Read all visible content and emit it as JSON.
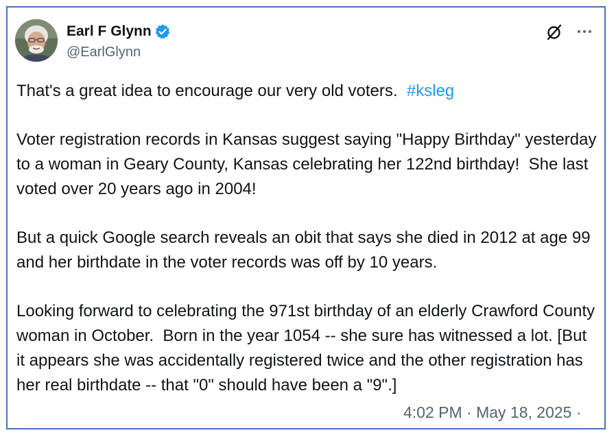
{
  "author": {
    "display_name": "Earl F Glynn",
    "handle": "@EarlGlynn",
    "verified": true
  },
  "icons": {
    "avatar": "profile-photo",
    "verified": "verified-badge-icon",
    "grok": "grok-icon",
    "more": "more-options-icon"
  },
  "colors": {
    "frame": "#4a6fbe",
    "hashtag": "#1d9bf0",
    "verified": "#1d9bf0",
    "secondary_text": "#536471"
  },
  "tweet": {
    "p1_text": "That's a great idea to encourage our very old voters.  ",
    "p1_hashtag": "#ksleg",
    "p2": "Voter registration records in Kansas suggest saying \"Happy Birthday\" yesterday to a woman in Geary County, Kansas celebrating her 122nd birthday!  She last voted over 20 years ago in 2004!",
    "p3": "But a quick Google search reveals an obit that says she died in 2012 at age 99 and her birthdate in the voter records was off by 10 years.",
    "p4": "Looking forward to celebrating the 971st birthday of an elderly Crawford County woman in October.  Born in the year 1054 -- she sure has witnessed a lot. [But it appears she was accidentally registered twice and the other registration has her real birthdate -- that \"0\" should have been a \"9\".]"
  },
  "meta": {
    "timestamp": "4:02 PM · May 18, 2025 ·"
  }
}
